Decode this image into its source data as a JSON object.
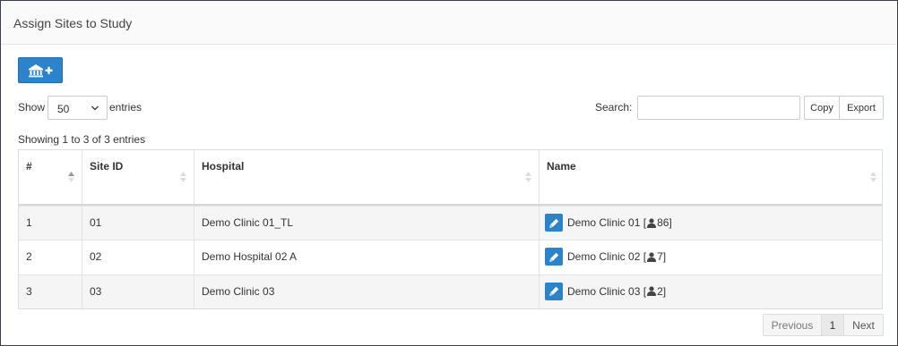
{
  "panel": {
    "title": "Assign Sites to Study"
  },
  "toolbar": {
    "add_button_icon": "bank-plus-icon"
  },
  "length": {
    "show_label": "Show",
    "selected": "50",
    "entries_label": "entries"
  },
  "search": {
    "label": "Search:",
    "value": "",
    "placeholder": ""
  },
  "buttons": {
    "copy": "Copy",
    "export": "Export"
  },
  "info": "Showing 1 to 3 of 3 entries",
  "table": {
    "columns": [
      "#",
      "Site ID",
      "Hospital",
      "Name"
    ],
    "rows": [
      {
        "num": "1",
        "site_id": "01",
        "hospital": "Demo Clinic 01_TL",
        "name": "Demo Clinic 01",
        "open": "[",
        "count": "86]"
      },
      {
        "num": "2",
        "site_id": "02",
        "hospital": "Demo Hospital 02 A",
        "name": "Demo Clinic 02",
        "open": "[",
        "count": "7]"
      },
      {
        "num": "3",
        "site_id": "03",
        "hospital": "Demo Clinic 03",
        "name": "Demo Clinic 03",
        "open": "[",
        "count": "2]"
      }
    ]
  },
  "pagination": {
    "previous": "Previous",
    "page": "1",
    "next": "Next"
  },
  "colors": {
    "accent": "#2c83c9",
    "row_striped": "#f5f5f5"
  }
}
